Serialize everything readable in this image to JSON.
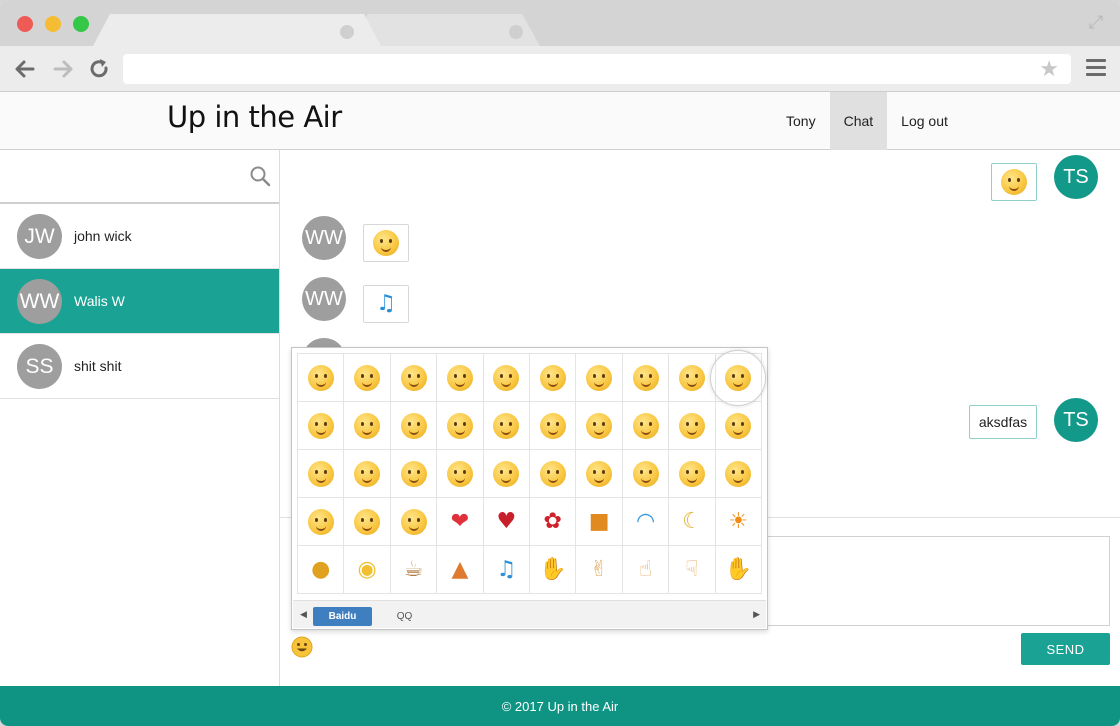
{
  "app": {
    "logo_text": "Up in the Air",
    "nav": [
      {
        "label": "Tony"
      },
      {
        "label": "Chat"
      },
      {
        "label": "Log out"
      }
    ],
    "footer_text": "© 2017 Up in the Air"
  },
  "sidebar": {
    "search_placeholder": "",
    "contacts": [
      {
        "initials": "JW",
        "name": "john wick"
      },
      {
        "initials": "WW",
        "name": "Walis W"
      },
      {
        "initials": "SS",
        "name": "shit shit"
      }
    ]
  },
  "chat": {
    "messages": [
      {
        "from": "TS",
        "side": "right",
        "content_type": "emoji",
        "emoji": "yum-face-icon"
      },
      {
        "from": "WW",
        "side": "left",
        "content_type": "emoji",
        "emoji": "grin-face-icon"
      },
      {
        "from": "WW",
        "side": "left",
        "content_type": "emoji",
        "emoji": "music-note-icon"
      },
      {
        "from": "TS",
        "side": "right",
        "content_type": "text",
        "text": "aksdfas"
      }
    ],
    "send_label": "SEND"
  },
  "emoji_panel": {
    "tabs": [
      {
        "label": "Baidu",
        "active": true
      },
      {
        "label": "QQ",
        "active": false
      }
    ],
    "rows": [
      [
        "smile",
        "grin",
        "yum",
        "grimace",
        "cool",
        "angry-teeth",
        "smirk",
        "sweat",
        "cry",
        "sneeze"
      ],
      [
        "hug",
        "frown",
        "point",
        "think",
        "kiss",
        "red-angry",
        "sick",
        "shocked",
        "shh",
        "love-eyes"
      ],
      [
        "tongue",
        "mad",
        "shy",
        "laugh-hands",
        "happy",
        "wink",
        "tears",
        "big-eyes",
        "sleepy",
        "scared"
      ],
      [
        "furious",
        "shout",
        "blush",
        "hearts",
        "broken-heart",
        "rose",
        "gift",
        "rainbow",
        "moon",
        "sun"
      ],
      [
        "coins",
        "bulb",
        "coffee",
        "cake",
        "music",
        "rock-hand",
        "victory",
        "thumbs-up",
        "thumbs-down",
        "ok-hand"
      ]
    ]
  },
  "colors": {
    "accent": "#1aa394",
    "footer": "#0f9484",
    "avatar_grey": "#9e9e9e",
    "tab_active": "#3f7fbf"
  }
}
